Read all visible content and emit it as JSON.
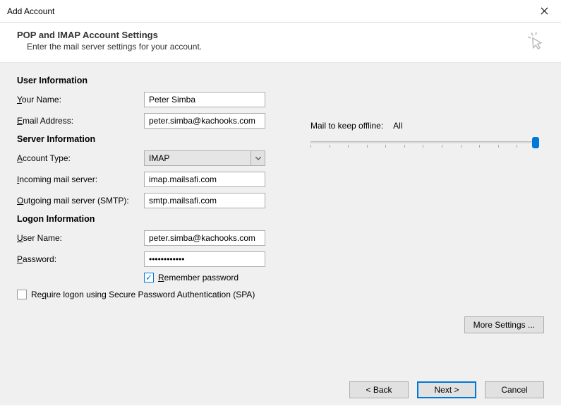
{
  "window": {
    "title": "Add Account"
  },
  "header": {
    "title": "POP and IMAP Account Settings",
    "subtitle": "Enter the mail server settings for your account."
  },
  "sections": {
    "user": {
      "title": "User Information",
      "your_name_label": "Your Name:",
      "your_name_value": "Peter Simba",
      "email_label": "Email Address:",
      "email_value": "peter.simba@kachooks.com"
    },
    "server": {
      "title": "Server Information",
      "account_type_label": "Account Type:",
      "account_type_value": "IMAP",
      "incoming_label": "Incoming mail server:",
      "incoming_value": "imap.mailsafi.com",
      "outgoing_label": "Outgoing mail server (SMTP):",
      "outgoing_value": "smtp.mailsafi.com"
    },
    "logon": {
      "title": "Logon Information",
      "user_label": "User Name:",
      "user_value": "peter.simba@kachooks.com",
      "password_label": "Password:",
      "password_value": "************",
      "remember_label": "Remember password",
      "remember_checked": true,
      "spa_label": "Require logon using Secure Password Authentication (SPA)",
      "spa_checked": false
    }
  },
  "offline": {
    "label": "Mail to keep offline:",
    "value": "All"
  },
  "buttons": {
    "more_settings": "More Settings ...",
    "back": "< Back",
    "next": "Next >",
    "cancel": "Cancel"
  }
}
